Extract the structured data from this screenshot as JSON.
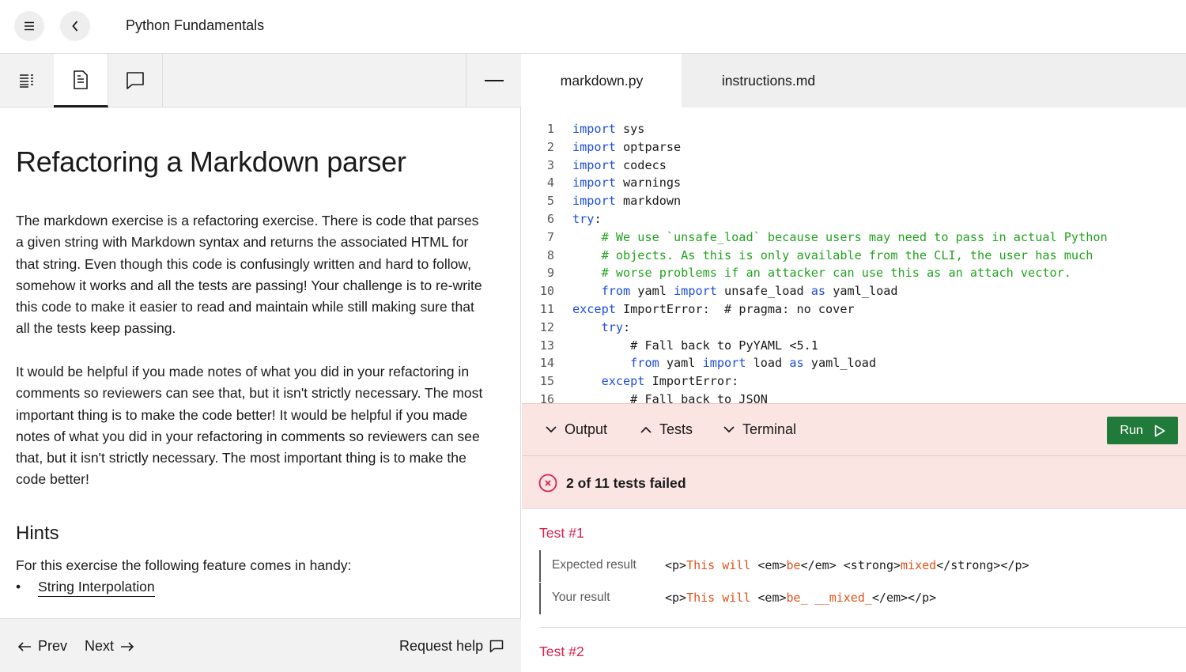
{
  "app": {
    "title": "Python Fundamentals"
  },
  "left_tabs": [
    "list-icon",
    "document-icon",
    "chat-icon"
  ],
  "article": {
    "title": "Refactoring a Markdown parser",
    "paragraph1": "The markdown exercise is a refactoring exercise. There is code that parses a given string with Markdown syntax and returns the associated HTML for that string. Even though this code is confusingly written and hard to follow, somehow it works and all the tests are passing! Your challenge is to re-write this code to make it easier to read and maintain while still making sure that all the tests keep passing.",
    "paragraph2": "It would be helpful if you made notes of what you did in your refactoring in comments so reviewers can see that, but it isn't strictly necessary. The most important thing is to make the code better! It would be helpful if you made notes of what you did in your refactoring in comments so reviewers can see that, but it isn't strictly necessary. The most important thing is to make the code better!",
    "hints_heading": "Hints",
    "hints_intro": "For this exercise the following feature comes in handy:",
    "hints": [
      "String Interpolation"
    ]
  },
  "footer": {
    "prev": "Prev",
    "next": "Next",
    "help": "Request help"
  },
  "file_tabs": [
    "markdown.py",
    "instructions.md"
  ],
  "code_lines": [
    {
      "n": "1",
      "indent": "",
      "parts": [
        [
          "kw",
          "import"
        ],
        [
          "",
          "  sys"
        ]
      ]
    },
    {
      "n": "2",
      "indent": "",
      "parts": [
        [
          "kw",
          "import"
        ],
        [
          "",
          "  optparse"
        ]
      ]
    },
    {
      "n": "3",
      "indent": "",
      "parts": [
        [
          "kw",
          "import"
        ],
        [
          "",
          "  codecs"
        ]
      ]
    },
    {
      "n": "4",
      "indent": "",
      "parts": [
        [
          "kw",
          "import"
        ],
        [
          "",
          "  warnings"
        ]
      ]
    },
    {
      "n": "5",
      "indent": "",
      "parts": [
        [
          "kw",
          "import"
        ],
        [
          "",
          "  markdown"
        ]
      ]
    },
    {
      "n": "6",
      "indent": "",
      "parts": [
        [
          "kw",
          "try"
        ],
        [
          "",
          ":"
        ]
      ]
    },
    {
      "n": "7",
      "indent": "    ",
      "parts": [
        [
          "cm",
          "# We use `unsafe_load` because users may need to pass in actual Python"
        ]
      ]
    },
    {
      "n": "8",
      "indent": "    ",
      "parts": [
        [
          "cm",
          "# objects. As this is only available from the CLI, the user has much"
        ]
      ]
    },
    {
      "n": "9",
      "indent": "    ",
      "parts": [
        [
          "cm",
          "# worse problems if an attacker can use this as an attach vector."
        ]
      ]
    },
    {
      "n": "10",
      "indent": "    ",
      "parts": [
        [
          "kw",
          "from"
        ],
        [
          "",
          " yaml "
        ],
        [
          "kw",
          "import"
        ],
        [
          "",
          " unsafe_load "
        ],
        [
          "kw",
          "as"
        ],
        [
          "",
          " yaml_load"
        ]
      ]
    },
    {
      "n": "11",
      "indent": "",
      "parts": [
        [
          "kw",
          "except"
        ],
        [
          "",
          " ImportError:  # pragma: no cover"
        ]
      ]
    },
    {
      "n": "12",
      "indent": "    ",
      "parts": [
        [
          "kw",
          "try"
        ],
        [
          "",
          ":"
        ]
      ]
    },
    {
      "n": "13",
      "indent": "        ",
      "parts": [
        [
          "",
          "# Fall back to PyYAML <5.1"
        ]
      ]
    },
    {
      "n": "14",
      "indent": "        ",
      "parts": [
        [
          "kw",
          "from"
        ],
        [
          "",
          " yaml "
        ],
        [
          "kw",
          "import"
        ],
        [
          "",
          " load "
        ],
        [
          "kw",
          "as"
        ],
        [
          "",
          " yaml_load"
        ]
      ]
    },
    {
      "n": "15",
      "indent": "    ",
      "parts": [
        [
          "kw",
          "except"
        ],
        [
          "",
          " ImportError:"
        ]
      ]
    },
    {
      "n": "16",
      "indent": "        ",
      "parts": [
        [
          "",
          "# Fall back to JSON"
        ]
      ]
    }
  ],
  "panel": {
    "output": "Output",
    "tests": "Tests",
    "terminal": "Terminal",
    "run": "Run"
  },
  "status": {
    "text": "2 of 11 tests failed"
  },
  "tests": [
    {
      "title": "Test #1",
      "expected_label": "Expected result",
      "expected": [
        [
          "tag",
          "<p>"
        ],
        [
          "txt",
          "This will"
        ],
        [
          "tag",
          " <em>"
        ],
        [
          "txt",
          "be"
        ],
        [
          "tag",
          "</em> <strong>"
        ],
        [
          "txt",
          "mixed"
        ],
        [
          "tag",
          "</strong></p>"
        ]
      ],
      "your_label": "Your result",
      "yours": [
        [
          "tag",
          "<p>"
        ],
        [
          "txt",
          "This will"
        ],
        [
          "tag",
          " <em>"
        ],
        [
          "txt",
          "be_ __mixed_"
        ],
        [
          "tag",
          "</em></p>"
        ]
      ]
    },
    {
      "title": "Test #2"
    }
  ],
  "colors": {
    "keyword": "#1d4ed8",
    "comment": "#22a31f",
    "error": "#d6224b",
    "run": "#207a3a",
    "fail_bg": "#fbe5e3"
  }
}
